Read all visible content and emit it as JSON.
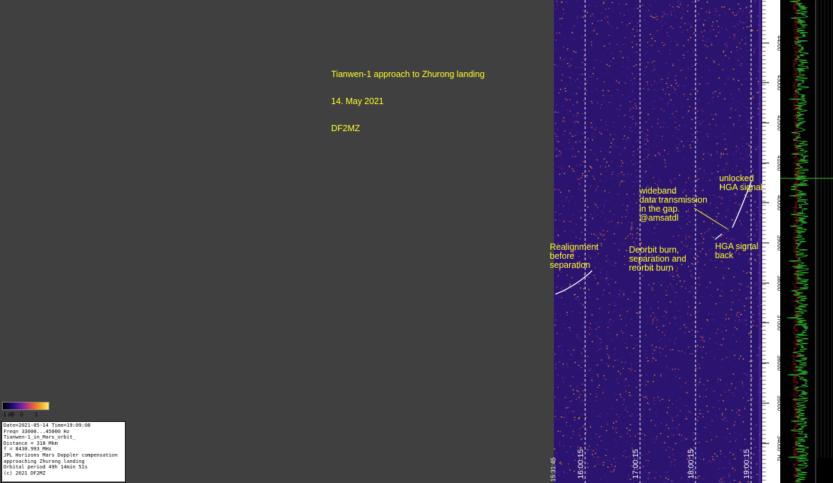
{
  "title_block": {
    "line1": "Tianwen-1 approach to Zhurong landing",
    "line2": "14. May 2021",
    "line3": "DF2MZ"
  },
  "annotations": {
    "realignment": "Realignment\nbefore\nseparation",
    "deorbit": "Deorbit burn,\nseparation and\nreorbit burn",
    "wideband": "wideband\ndata transmission\nin the gap\n@amsatdl",
    "unlocked": "unlocked\nHGA signal",
    "hga_back": "HGA signal\nback"
  },
  "time_labels": [
    "16:00:15",
    "17:00:15",
    "18:00:15",
    "19:00:15"
  ],
  "start_time_label": "15:31:45",
  "freq_labels": [
    "44000",
    "43000",
    "42000",
    "41000",
    "40000",
    "39000",
    "38000",
    "37000",
    "36000",
    "35000",
    "34000"
  ],
  "freq_unit": "Hz",
  "colorbar": {
    "left_label": "-1 dB",
    "mid_label": "0",
    "right_label": "1"
  },
  "info_panel": {
    "lines": [
      "Date=2021-05-14 Time=19:09:08",
      "Freq= 33000...45000 Hz",
      "Tianwen-1_in_Mars_orbit_",
      "Distance = 318 Mkm",
      "f = 8430.993_MHz",
      "JPL Horizons Mars Doppler compensation",
      "approaching Zhurong landing",
      "Orbital period 49h 14min 51s",
      "(c) 2021 DF2MZ"
    ]
  },
  "colors": {
    "background": "#404040",
    "waterfall_base": "#2b1470",
    "annotation": "#ffff2a",
    "scope_trace": "#2fd22f",
    "scope_peak": "#e02020"
  }
}
